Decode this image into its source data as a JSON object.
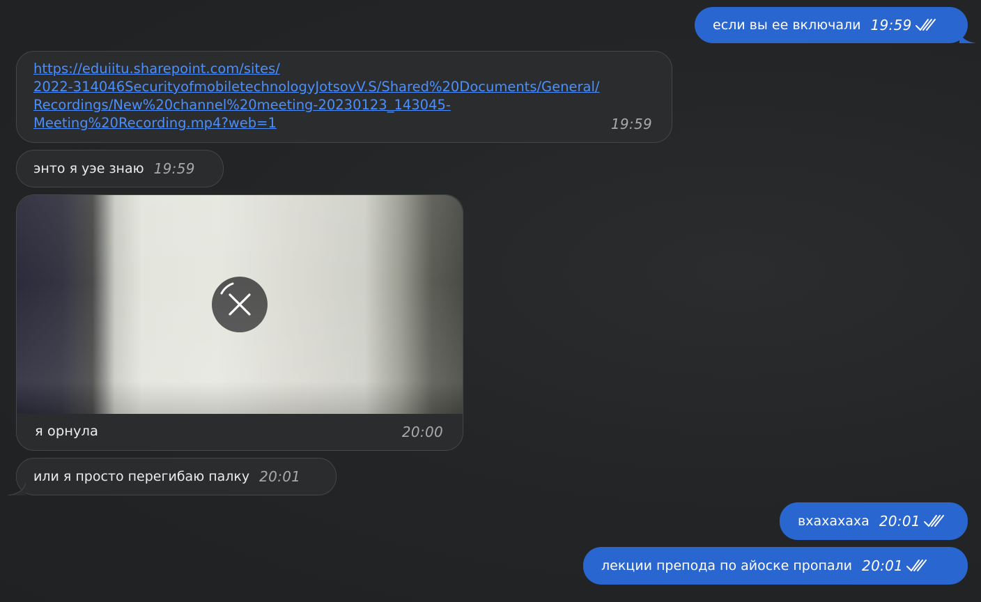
{
  "messages": {
    "m1": {
      "text": "если вы ее включали",
      "time": "19:59"
    },
    "m2": {
      "link_lines": [
        "https://eduiitu.sharepoint.com/sites/",
        "2022-314046SecurityofmobiletechnologyJotsovV.S/Shared%20Documents/General/",
        "Recordings/New%20channel%20meeting-20230123_143045-",
        "Meeting%20Recording.mp4?web=1"
      ],
      "time": "19:59"
    },
    "m3": {
      "text": "энто я уэе знаю",
      "time": "19:59"
    },
    "m4": {
      "caption": "я орнула",
      "time": "20:00",
      "media_icon": "close-icon"
    },
    "m5": {
      "text": "или я просто перегибаю палку",
      "time": "20:01"
    },
    "m6": {
      "text": "вхахахаха",
      "time": "20:01"
    },
    "m7": {
      "text": "лекции препода по айоске пропали",
      "time": "20:01"
    }
  },
  "colors": {
    "background": "#222426",
    "incoming_bubble": "#2b2c2e",
    "outgoing_bubble": "#2a66cf",
    "link": "#4a8fff"
  },
  "icons": {
    "read_status": "double-check-icon",
    "media_cancel": "close-icon"
  }
}
